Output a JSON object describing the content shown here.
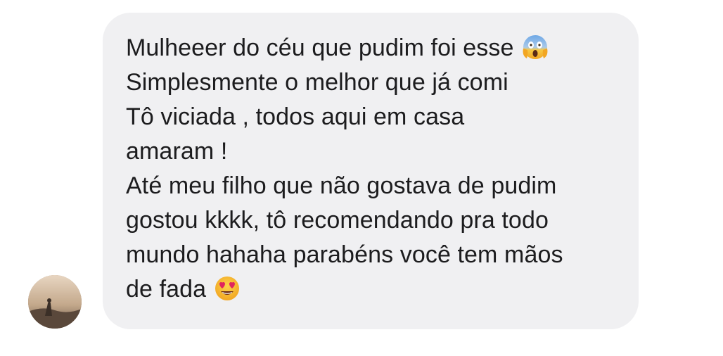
{
  "message": {
    "lines": [
      "Mulheeer do céu que pudim foi esse",
      "Simplesmente o melhor que já comi",
      "Tô viciada , todos aqui em casa",
      "amaram !",
      "Até meu filho que não gostava de pudim",
      "gostou kkkk, tô recomendando pra todo",
      "mundo hahaha parabéns você tem mãos",
      "de fada"
    ],
    "emoji_line1": "screaming-face-emoji",
    "emoji_last": "heart-eyes-emoji"
  },
  "colors": {
    "bubble_bg": "#f0f0f2",
    "text": "#1c1c1e"
  }
}
